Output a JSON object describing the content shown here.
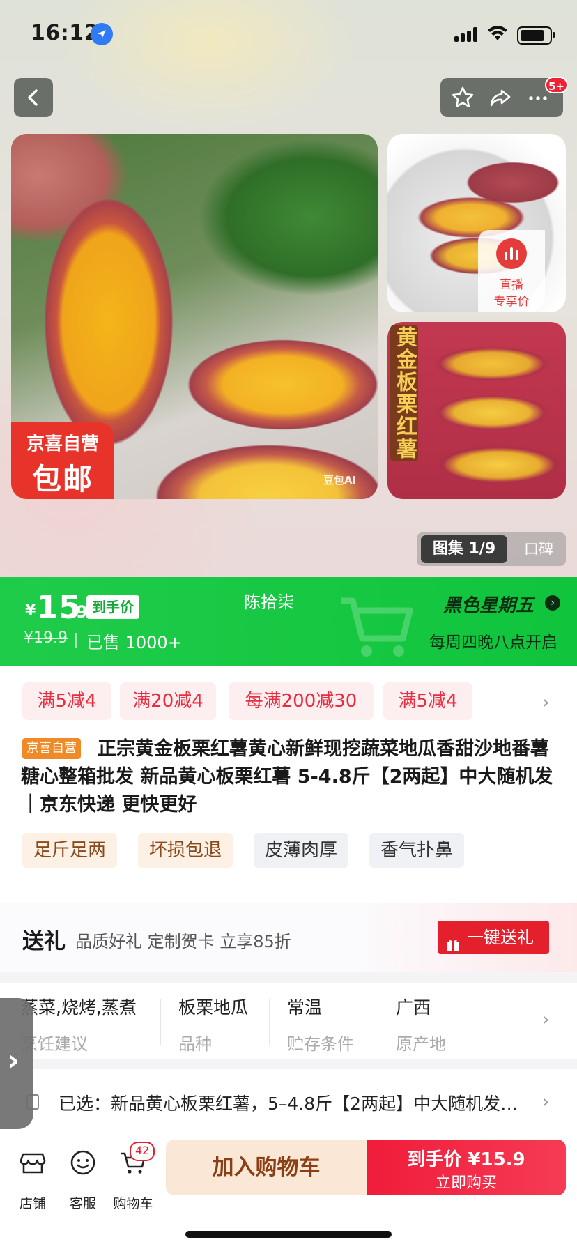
{
  "status_bar": {
    "time": "16:12"
  },
  "nav": {
    "more_badge": "5+"
  },
  "gallery": {
    "stamp_line1": "京喜自营",
    "stamp_line2": "包邮",
    "watermark": "豆包AI",
    "live_label1": "直播",
    "live_label2": "专享价",
    "thumb2_vertical_label": "黄金板栗红薯",
    "tab_active": "图集 1/9",
    "tab_review": "口碑"
  },
  "price_banner": {
    "currency": "¥",
    "price_int": "15",
    "price_dec": ".9",
    "final_price_tag": "到手价",
    "original_price": "¥19.9",
    "sold": "已售 1000+",
    "seller": "陈拾柒",
    "event_title": "黑色星期五",
    "event_sub": "每周四晚八点开启"
  },
  "coupons": [
    "满5减4",
    "满20减4",
    "每满200减30",
    "满5减4"
  ],
  "product": {
    "tag": "京喜自营",
    "title": "正宗黄金板栗红薯黄心新鲜现挖蔬菜地瓜香甜沙地番薯糖心整箱批发 新品黄心板栗红薯 5-4.8斤【2两起】中大随机发｜京东快递 更快更好"
  },
  "features": [
    "足斤足两",
    "坏损包退",
    "皮薄肉厚",
    "香气扑鼻"
  ],
  "gift": {
    "title": "送礼",
    "subtitle": "品质好礼 定制贺卡 立享85折",
    "button": "一键送礼"
  },
  "specs": [
    {
      "value": "蒸菜,烧烤,蒸煮",
      "key": "烹饪建议"
    },
    {
      "value": "板栗地瓜",
      "key": "品种"
    },
    {
      "value": "常温",
      "key": "贮存条件"
    },
    {
      "value": "广西",
      "key": "原产地"
    }
  ],
  "selected": {
    "text": "已选：新品黄心板栗红薯，5–4.8斤【2两起】中大随机发｜京东快递 更快更好"
  },
  "bottom_bar": {
    "store_label": "店铺",
    "service_label": "客服",
    "cart_label": "购物车",
    "cart_count": "42",
    "add_to_cart": "加入购物车",
    "buy_line1": "到手价 ¥15.9",
    "buy_line2": "立即购买"
  },
  "colors": {
    "accent_red": "#e5202d",
    "banner_green": "#1fcc4a",
    "coupon_bg": "#fdeef0"
  }
}
